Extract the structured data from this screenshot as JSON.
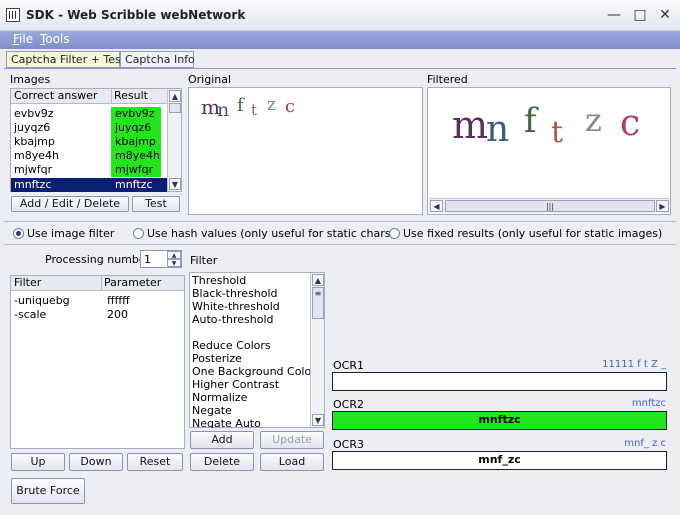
{
  "window": {
    "title": "SDK - Web Scribble webNetwork",
    "minimize": "—",
    "maximize": "□",
    "close": "✕"
  },
  "menu": {
    "file": "File",
    "tools": "Tools"
  },
  "tabs": [
    "Captcha Filter + Test",
    "Captcha Info"
  ],
  "images": {
    "label": "Images",
    "col_answer": "Correct answer",
    "col_result": "Result",
    "rows": [
      {
        "answer": "evbv9z",
        "result": "evbv9z"
      },
      {
        "answer": "juyqz6",
        "result": "juyqz6"
      },
      {
        "answer": "kbajmp",
        "result": "kbajmp"
      },
      {
        "answer": "m8ye4h",
        "result": "m8ye4h"
      },
      {
        "answer": "mjwfqr",
        "result": "mjwfqr"
      },
      {
        "answer": "mnftzc",
        "result": "mnftzc"
      }
    ],
    "add_button": "Add / Edit / Delete",
    "test_button": "Test"
  },
  "original": {
    "label": "Original",
    "captcha": [
      "m",
      "n",
      "f",
      "t",
      "z",
      "c"
    ]
  },
  "filtered": {
    "label": "Filtered",
    "captcha": [
      "m",
      "n",
      "f",
      "t",
      "z",
      "c"
    ],
    "scroll_grip": "|||"
  },
  "mode": {
    "image_filter": "Use image filter",
    "hash": "Use hash values (only useful for static chars)",
    "fixed": "Use fixed results (only useful for static images)"
  },
  "processing": {
    "label": "Processing number",
    "value": "1"
  },
  "filter_table": {
    "col_filter": "Filter",
    "col_param": "Parameter",
    "rows": [
      {
        "filter": "-uniquebg",
        "param": "ffffff"
      },
      {
        "filter": "-scale",
        "param": "200"
      }
    ]
  },
  "filter_list": {
    "label": "Filter",
    "items": [
      "Threshold",
      "Black-threshold",
      "White-threshold",
      "Auto-threshold",
      "",
      "Reduce Colors",
      "Posterize",
      "One Background Color",
      "Higher Contrast",
      "Normalize",
      "Negate",
      "Negate Auto"
    ]
  },
  "buttons": {
    "add": "Add",
    "update": "Update",
    "delete": "Delete",
    "load": "Load",
    "up": "Up",
    "down": "Down",
    "reset": "Reset",
    "brute": "Brute Force"
  },
  "ocr": [
    {
      "label": "OCR1",
      "right": "11111 f t  Z _",
      "value": "",
      "color": "#FFFFFF"
    },
    {
      "label": "OCR2",
      "right": "mnftzc",
      "value": "mnftzc",
      "color": "#22E51B"
    },
    {
      "label": "OCR3",
      "right": "mnf_ z c",
      "value": "mnf_zc",
      "color": "#FFFFFF"
    }
  ],
  "colors": {
    "match": "#22E51B",
    "selected": "#0A1F73"
  }
}
